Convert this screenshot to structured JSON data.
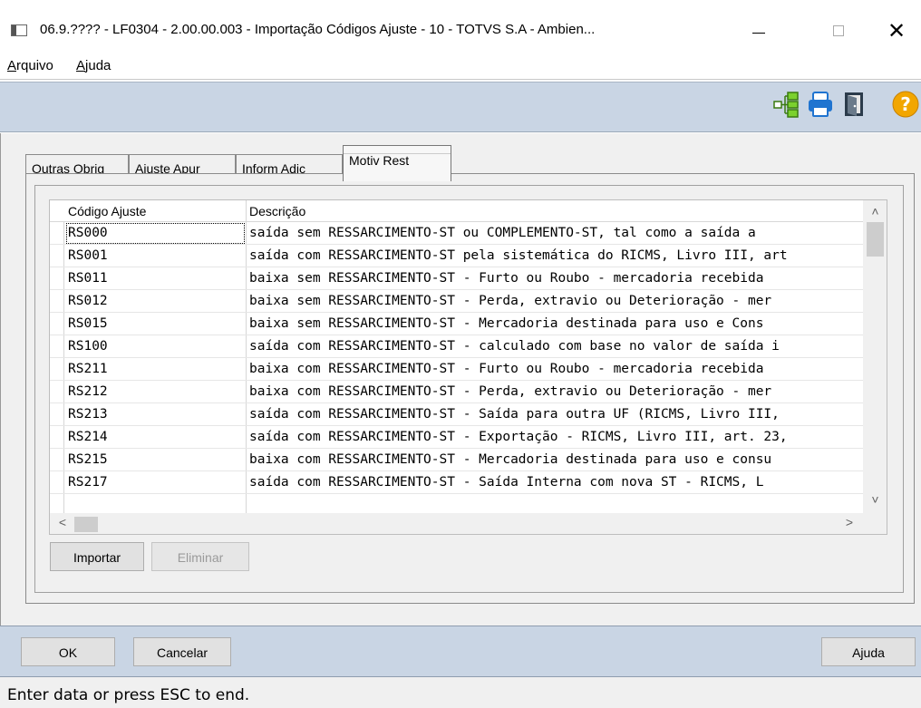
{
  "window": {
    "title": "06.9.???? - LF0304 - 2.00.00.003 - Importação Códigos Ajuste - 10 - TOTVS S.A - Ambien...",
    "minimize_symbol": "—",
    "close_symbol": "✕"
  },
  "menu": {
    "items": [
      {
        "label": "Arquivo",
        "mnemonic": "A"
      },
      {
        "label": "Ajuda",
        "mnemonic": "A"
      }
    ]
  },
  "toolbar": {
    "icons": [
      "tree-structure-icon",
      "printer-icon",
      "exit-door-icon",
      "help-icon"
    ],
    "help_glyph": "?",
    "colors": {
      "accent_green": "#6bbf2a",
      "printer_blue": "#1f74d0",
      "help_orange": "#f2a600",
      "background": "#c9d5e4"
    }
  },
  "tabs": [
    {
      "label": "Outras Obrig",
      "active": false
    },
    {
      "label": "Ajuste Apur",
      "active": false
    },
    {
      "label": "Inform Adic",
      "active": false
    },
    {
      "label": "Motiv Rest",
      "active": true
    }
  ],
  "grid": {
    "columns": [
      "Código Ajuste",
      "Descrição"
    ],
    "rows": [
      {
        "code": "RS000",
        "desc": "saída sem RESSARCIMENTO-ST ou COMPLEMENTO-ST, tal como a saída a"
      },
      {
        "code": "RS001",
        "desc": "saída com RESSARCIMENTO-ST pela sistemática do RICMS, Livro III, art"
      },
      {
        "code": "RS011",
        "desc": "baixa sem RESSARCIMENTO-ST - Furto ou Roubo - mercadoria recebida"
      },
      {
        "code": "RS012",
        "desc": "baixa sem RESSARCIMENTO-ST - Perda, extravio ou Deterioração - mer"
      },
      {
        "code": "RS015",
        "desc": "baixa sem RESSARCIMENTO-ST - Mercadoria destinada para uso e Cons"
      },
      {
        "code": "RS100",
        "desc": "saída com RESSARCIMENTO-ST - calculado com base no valor de saída i"
      },
      {
        "code": "RS211",
        "desc": "baixa com RESSARCIMENTO-ST - Furto ou Roubo - mercadoria recebida"
      },
      {
        "code": "RS212",
        "desc": "baixa com RESSARCIMENTO-ST - Perda, extravio ou Deterioração - mer"
      },
      {
        "code": "RS213",
        "desc": "saída com RESSARCIMENTO-ST - Saída para outra UF (RICMS, Livro III,"
      },
      {
        "code": "RS214",
        "desc": "saída com RESSARCIMENTO-ST - Exportação - RICMS, Livro III, art. 23,"
      },
      {
        "code": "RS215",
        "desc": "baixa com RESSARCIMENTO-ST - Mercadoria destinada para uso e consu"
      },
      {
        "code": "RS217",
        "desc": "saída com RESSARCIMENTO-ST - Saída Interna com nova ST - RICMS, L"
      }
    ],
    "scroll_up": "^",
    "scroll_down": "v",
    "scroll_left": "<",
    "scroll_right": ">"
  },
  "panel_buttons": {
    "import": "Importar",
    "delete": "Eliminar"
  },
  "footer_buttons": {
    "ok": "OK",
    "cancel": "Cancelar",
    "help": "Ajuda"
  },
  "status": {
    "text": "Enter data or press ESC to end."
  }
}
